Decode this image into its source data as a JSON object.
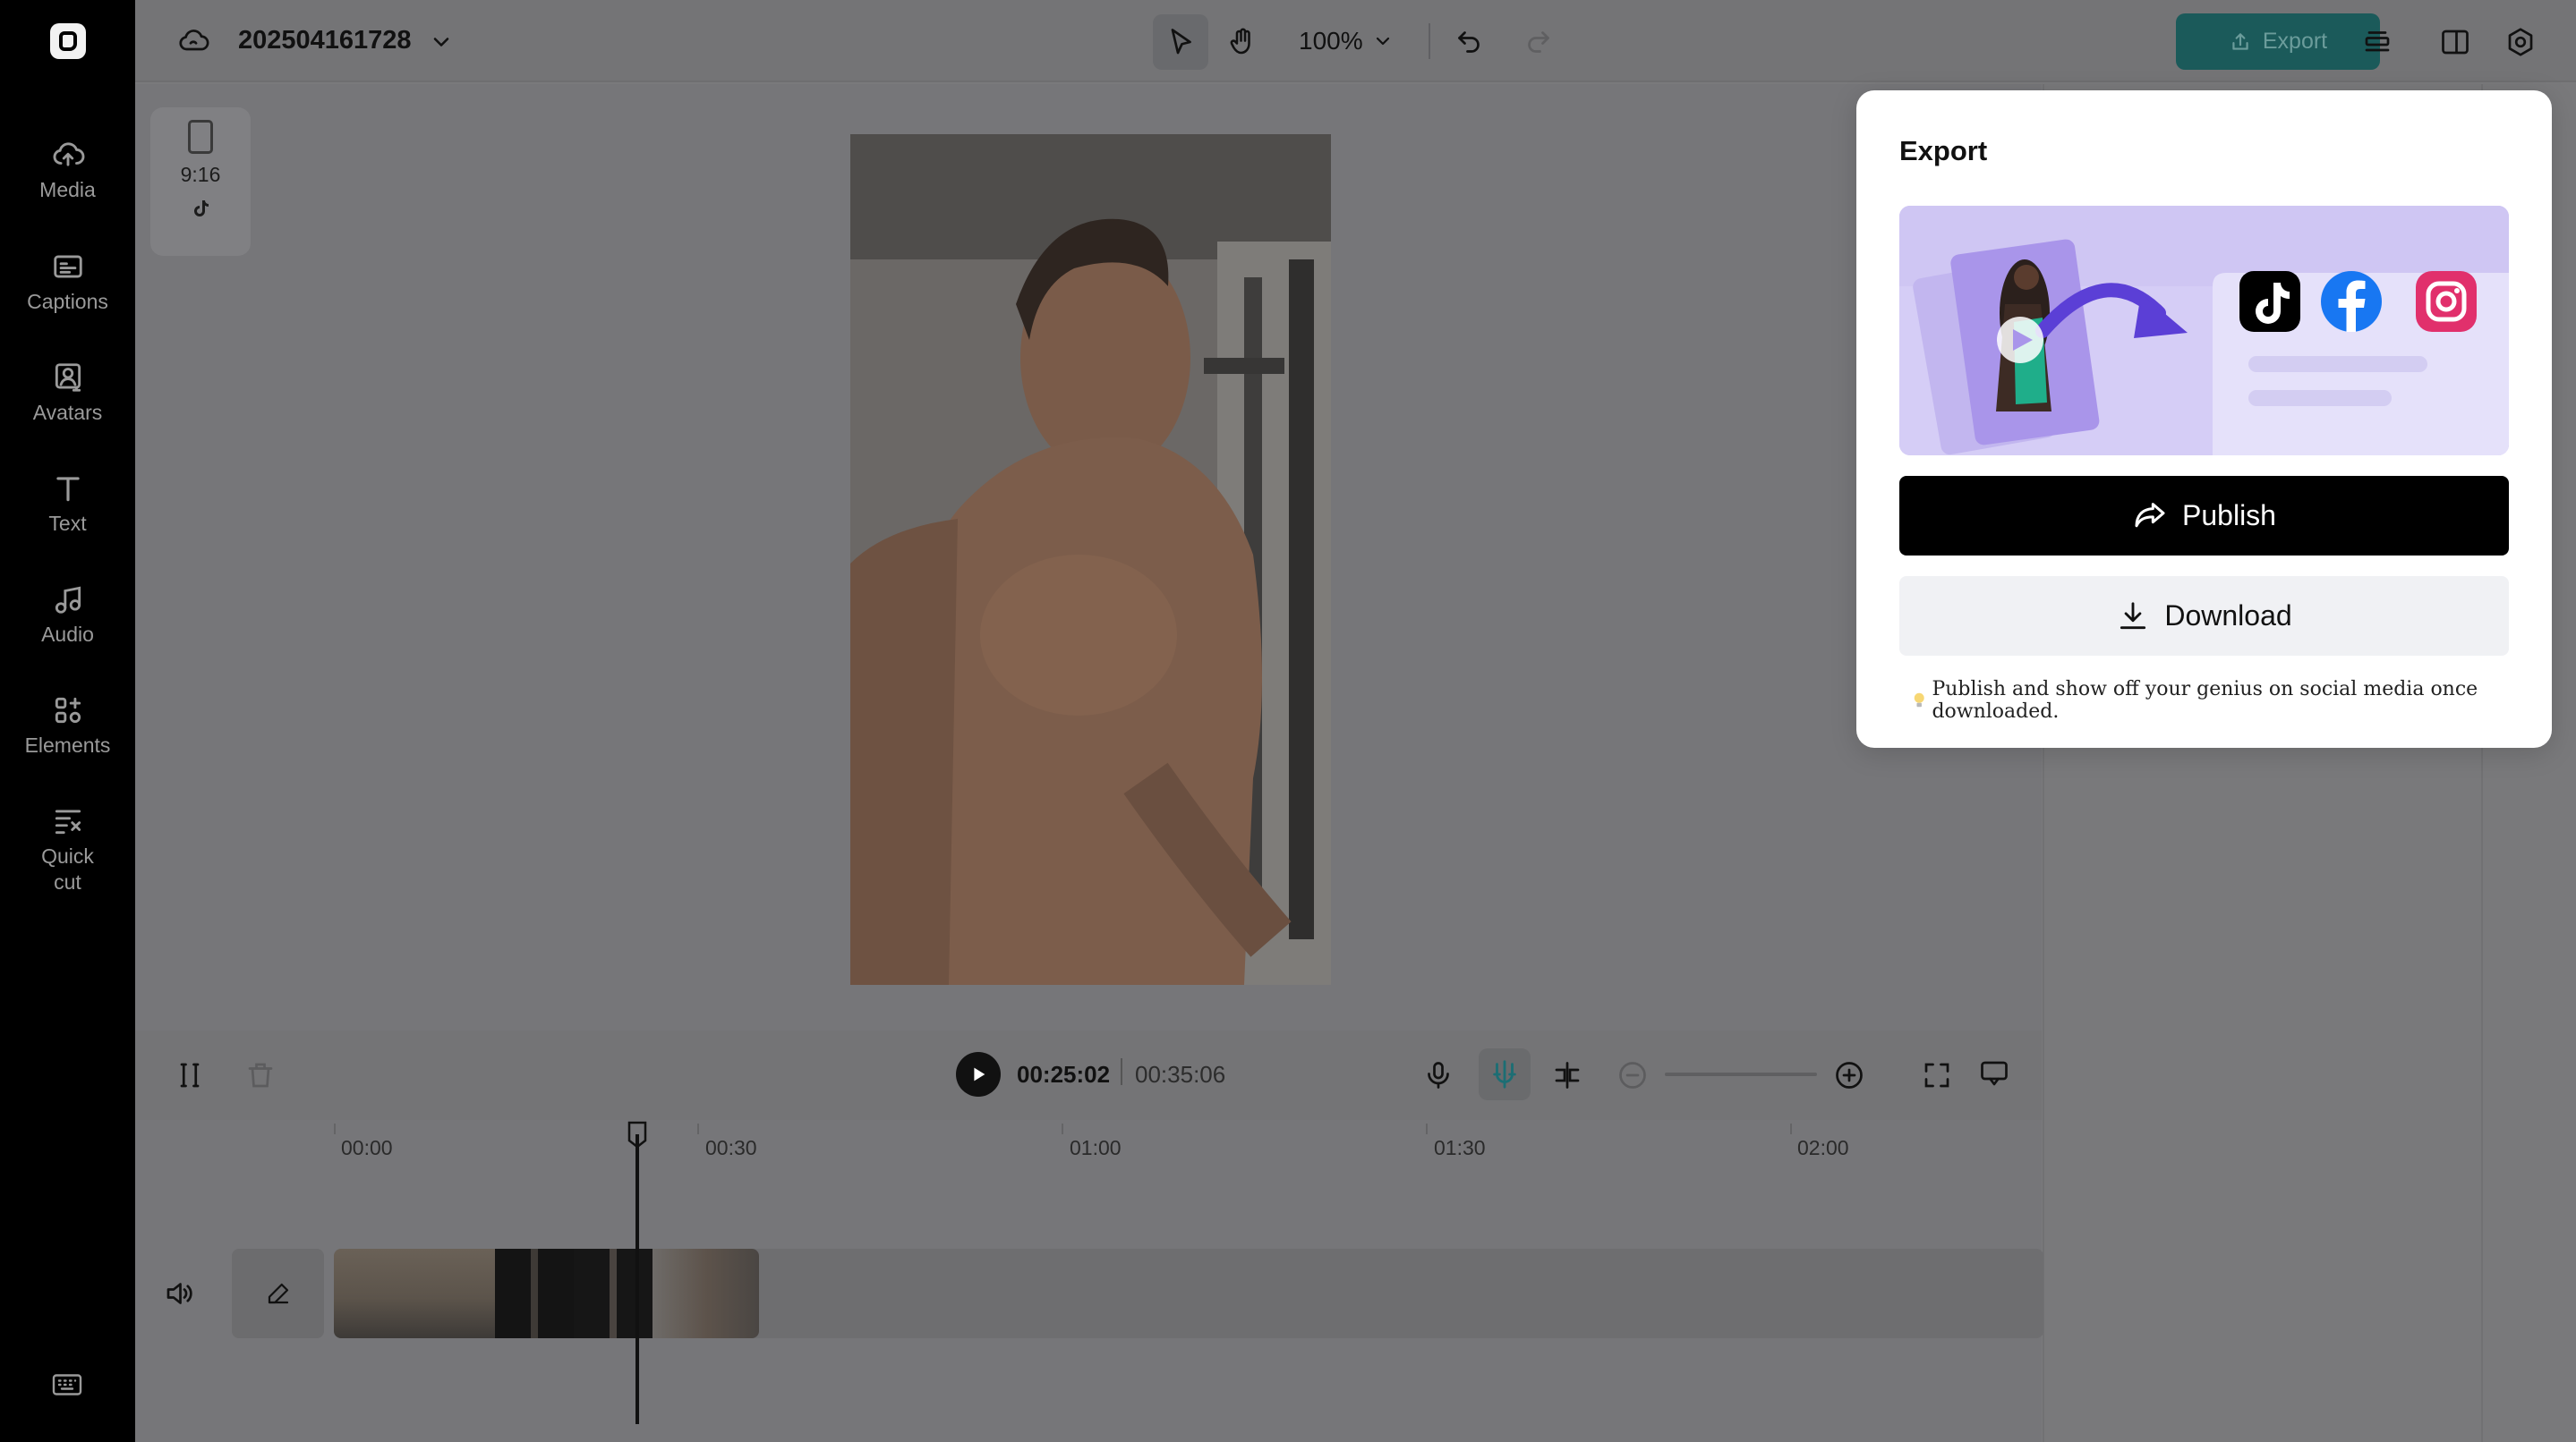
{
  "sidebar": {
    "items": [
      {
        "label": "Media",
        "icon": "cloud-upload-icon"
      },
      {
        "label": "Captions",
        "icon": "captions-icon"
      },
      {
        "label": "Avatars",
        "icon": "avatar-icon"
      },
      {
        "label": "Text",
        "icon": "text-icon"
      },
      {
        "label": "Audio",
        "icon": "music-note-icon"
      },
      {
        "label": "Elements",
        "icon": "elements-icon"
      },
      {
        "label": "Quick\ncut",
        "icon": "quick-cut-icon"
      }
    ]
  },
  "header": {
    "project_name": "202504161728",
    "zoom": "100%",
    "export_label": "Export"
  },
  "canvas": {
    "aspect_ratio": "9:16"
  },
  "timeline": {
    "current_time": "00:25:02",
    "total_time": "00:35:06",
    "ticks": [
      "00:00",
      "00:30",
      "01:00",
      "01:30",
      "02:00"
    ]
  },
  "export_popup": {
    "title": "Export",
    "publish_label": "Publish",
    "download_label": "Download",
    "tip": "Publish and show off your genius on social media once downloaded."
  },
  "colors": {
    "accent": "#1b5a5a",
    "promo_bg": "#d5cdf6",
    "arrow": "#5b3fd6"
  }
}
